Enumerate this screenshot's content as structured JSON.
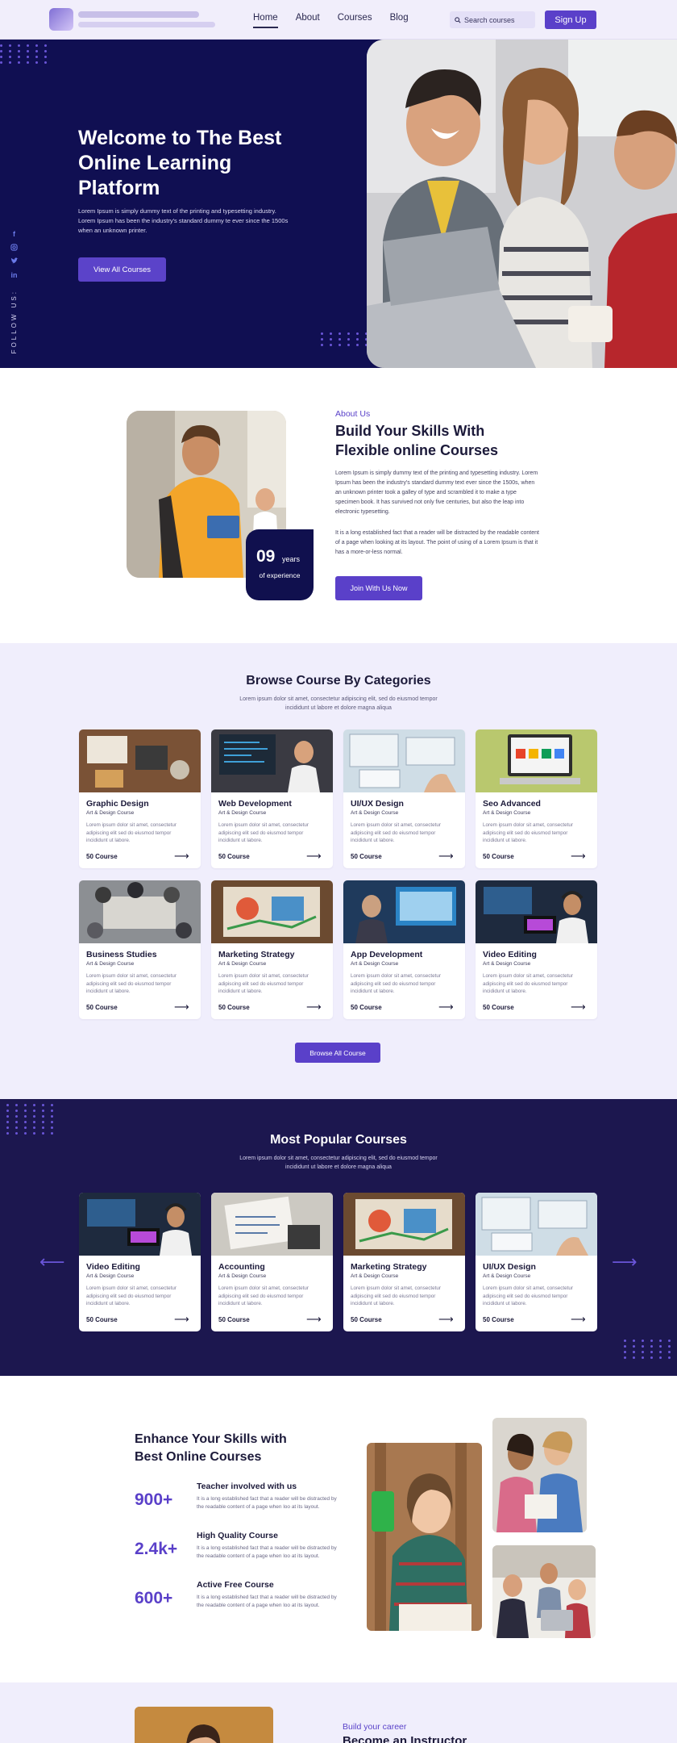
{
  "nav": {
    "links": [
      "Home",
      "About",
      "Courses",
      "Blog"
    ],
    "search_placeholder": "Search courses",
    "signup": "Sign Up"
  },
  "hero": {
    "title": "Welcome to The Best Online Learning Platform",
    "text": "Lorem Ipsum is simply dummy text of the printing and typesetting industry. Lorem Ipsum has been the industry's standard dummy te ever since the 1500s when an unknown printer.",
    "button": "View All Courses",
    "follow": "FOLLOW US:",
    "social_icons": [
      "facebook-icon",
      "instagram-icon",
      "twitter-icon",
      "linkedin-icon"
    ]
  },
  "about": {
    "kicker": "About Us",
    "title": "Build Your Skills With Flexible online Courses",
    "para1": "Lorem Ipsum is simply dummy text of the printing and typesetting industry. Lorem Ipsum has been the industry's standard dummy text ever since the 1500s, when an unknown printer took a galley of type and scrambled it to make a type specimen book. It has survived not only five centuries, but also the leap into electronic typesetting.",
    "para2": "It is a long established fact that a reader will be distracted by the readable content of a page when looking at its layout. The point of using of a Lorem Ipsum is that it has a more-or-less normal.",
    "button": "Join With Us Now",
    "exp_number": "09",
    "exp_years": "years",
    "exp_label": "of experience"
  },
  "categories": {
    "title": "Browse Course By Categories",
    "subtitle": "Lorem ipsum dolor sit amet, consectetur adipiscing elit, sed do eiusmod tempor incididunt ut labore et dolore magna aliqua",
    "items": [
      {
        "title": "Graphic Design",
        "sub": "Art & Design Course",
        "desc": "Lorem ipsum dolor sit amet, consectetur adipiscing elit sed do eiusmod tempor incididunt ut labore.",
        "count": "50 Course"
      },
      {
        "title": "Web Development",
        "sub": "Art & Design Course",
        "desc": "Lorem ipsum dolor sit amet, consectetur adipiscing elit sed do eiusmod tempor incididunt ut labore.",
        "count": "50 Course"
      },
      {
        "title": "UI/UX Design",
        "sub": "Art & Design Course",
        "desc": "Lorem ipsum dolor sit amet, consectetur adipiscing elit sed do eiusmod tempor incididunt ut labore.",
        "count": "50 Course"
      },
      {
        "title": "Seo Advanced",
        "sub": "Art & Design Course",
        "desc": "Lorem ipsum dolor sit amet, consectetur adipiscing elit sed do eiusmod tempor incididunt ut labore.",
        "count": "50 Course"
      },
      {
        "title": "Business Studies",
        "sub": "Art & Design Course",
        "desc": "Lorem ipsum dolor sit amet, consectetur adipiscing elit sed do eiusmod tempor incididunt ut labore.",
        "count": "50 Course"
      },
      {
        "title": "Marketing Strategy",
        "sub": "Art & Design Course",
        "desc": "Lorem ipsum dolor sit amet, consectetur adipiscing elit sed do eiusmod tempor incididunt ut labore.",
        "count": "50 Course"
      },
      {
        "title": "App Development",
        "sub": "Art & Design Course",
        "desc": "Lorem ipsum dolor sit amet, consectetur adipiscing elit sed do eiusmod tempor incididunt ut labore.",
        "count": "50 Course"
      },
      {
        "title": "Video Editing",
        "sub": "Art & Design Course",
        "desc": "Lorem ipsum dolor sit amet, consectetur adipiscing elit sed do eiusmod tempor incididunt ut labore.",
        "count": "50 Course"
      }
    ],
    "button": "Browse All Course"
  },
  "popular": {
    "title": "Most Popular Courses",
    "subtitle": "Lorem ipsum dolor sit amet, consectetur adipiscing elit, sed do eiusmod tempor incididunt ut labore et dolore magna aliqua",
    "items": [
      {
        "title": "Video Editing",
        "sub": "Art & Design Course",
        "desc": "Lorem ipsum dolor sit amet, consectetur adipiscing elit sed do eiusmod tempor incididunt ut labore.",
        "count": "50 Course"
      },
      {
        "title": "Accounting",
        "sub": "Art & Design Course",
        "desc": "Lorem ipsum dolor sit amet, consectetur adipiscing elit sed do eiusmod tempor incididunt ut labore.",
        "count": "50 Course"
      },
      {
        "title": "Marketing Strategy",
        "sub": "Art & Design Course",
        "desc": "Lorem ipsum dolor sit amet, consectetur adipiscing elit sed do eiusmod tempor incididunt ut labore.",
        "count": "50 Course"
      },
      {
        "title": "UI/UX Design",
        "sub": "Art & Design Course",
        "desc": "Lorem ipsum dolor sit amet, consectetur adipiscing elit sed do eiusmod tempor incididunt ut labore.",
        "count": "50 Course"
      }
    ]
  },
  "enhance": {
    "title": "Enhance Your Skills with Best Online Courses",
    "stats": [
      {
        "number": "900+",
        "title": "Teacher involved with us",
        "desc": "It is a long established fact that a reader will be distracted by the readable content of a page when loo at its layout."
      },
      {
        "number": "2.4k+",
        "title": "High Quality Course",
        "desc": "It is a long established fact that a reader will be distracted by the readable content of a page when loo at its layout."
      },
      {
        "number": "600+",
        "title": "Active Free Course",
        "desc": "It is a long established fact that a reader will be distracted by the readable content of a page when loo at its layout."
      }
    ]
  },
  "instructor": {
    "kicker": "Build your career",
    "title": "Become an Instructor"
  },
  "colors": {
    "primary": "#5a40c9",
    "navy": "#100f52",
    "popular_bg": "#1c174f",
    "light_bg": "#f0eefc"
  }
}
